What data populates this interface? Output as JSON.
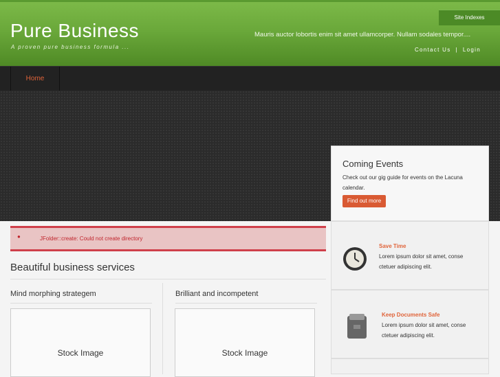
{
  "header": {
    "title": "Pure Business",
    "tagline": "A proven pure business formula ...",
    "site_indexes": "Site Indexes",
    "description": "Mauris auctor lobortis enim sit amet ullamcorper. Nullam sodales tempor....",
    "contact": "Contact Us",
    "separator": "|",
    "login": "Login"
  },
  "nav": {
    "items": [
      {
        "label": "Home"
      }
    ]
  },
  "events": {
    "title": "Coming Events",
    "text": "Check out our gig guide for events on the Lacuna calendar.",
    "button": "Find out more"
  },
  "error": {
    "bullet": "●",
    "message": "JFolder::create: Could not create directory"
  },
  "main": {
    "title": "Beautiful business services",
    "columns": [
      {
        "title": "Mind morphing strategem",
        "image_label": "Stock Image"
      },
      {
        "title": "Brilliant and incompetent",
        "image_label": "Stock Image"
      }
    ]
  },
  "features": [
    {
      "title": "Save Time",
      "text": "Lorem ipsum dolor sit amet, conse ctetuer adipiscing elit.",
      "icon": "clock-icon"
    },
    {
      "title": "Keep Documents Safe",
      "text": "Lorem ipsum dolor sit amet, conse ctetuer adipiscing elit.",
      "icon": "document-safe-icon"
    }
  ],
  "colors": {
    "brand_green": "#6aa83a",
    "accent_orange": "#e0643a",
    "error_red": "#c0252d"
  }
}
